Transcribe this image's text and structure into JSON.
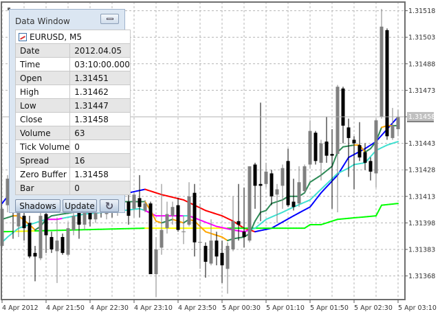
{
  "data_window": {
    "title": "Data Window",
    "symbol": "EURUSD, M5",
    "rows": [
      {
        "label": "Date",
        "value": "2012.04.05"
      },
      {
        "label": "Time",
        "value": "03:10:00.000"
      },
      {
        "label": "Open",
        "value": "1.31451"
      },
      {
        "label": "High",
        "value": "1.31462"
      },
      {
        "label": "Low",
        "value": "1.31447"
      },
      {
        "label": "Close",
        "value": "1.31458"
      },
      {
        "label": "Volume",
        "value": "63"
      },
      {
        "label": "Tick Volume",
        "value": "0"
      },
      {
        "label": "Spread",
        "value": "16"
      },
      {
        "label": "Zero Buffer",
        "value": "1.31458"
      },
      {
        "label": "Bar",
        "value": "0"
      }
    ],
    "buttons": {
      "shadows": "Shadows",
      "update": "Update",
      "refresh_icon": "refresh-icon"
    }
  },
  "chart_data": {
    "type": "candlestick",
    "symbol": "EURUSD",
    "timeframe": "M5",
    "first_bar": "4 Apr 21:10",
    "last_bar": "5 Apr 03:10",
    "current_price": "1.31458",
    "ylim": [
      1.31353,
      1.31525
    ],
    "y_ticks": [
      "1.31518",
      "1.31503",
      "1.31488",
      "1.31473",
      "1.31458",
      "1.31443",
      "1.31428",
      "1.31413",
      "1.31398",
      "1.31383",
      "1.31368"
    ],
    "x_ticks": [
      {
        "bar": 0,
        "label": "4 Apr 2012"
      },
      {
        "bar": 8,
        "label": "4 Apr 21:50"
      },
      {
        "bar": 16,
        "label": "4 Apr 22:30"
      },
      {
        "bar": 24,
        "label": "4 Apr 23:10"
      },
      {
        "bar": 32,
        "label": "4 Apr 23:50"
      },
      {
        "bar": 40,
        "label": "5 Apr 00:30"
      },
      {
        "bar": 48,
        "label": "5 Apr 01:10"
      },
      {
        "bar": 56,
        "label": "5 Apr 01:50"
      },
      {
        "bar": 64,
        "label": "5 Apr 02:30"
      },
      {
        "bar": 72,
        "label": "5 Apr 03:10"
      }
    ],
    "colors": {
      "up": "#808080",
      "down": "#000000",
      "grid": "#b4b4b4",
      "frame": "#6e6e6e"
    },
    "candles_ohlc": [
      [
        1.31385,
        1.31407,
        1.31384,
        1.31406
      ],
      [
        1.31408,
        1.31425,
        1.31404,
        1.31423
      ],
      [
        1.31415,
        1.31417,
        1.31389,
        1.31406
      ],
      [
        1.31396,
        1.31409,
        1.3139,
        1.31407
      ],
      [
        1.31402,
        1.31407,
        1.31388,
        1.31395
      ],
      [
        1.31398,
        1.31402,
        1.31378,
        1.31379
      ],
      [
        1.31381,
        1.31385,
        1.31365,
        1.31379
      ],
      [
        1.31378,
        1.31404,
        1.31377,
        1.31402
      ],
      [
        1.31403,
        1.31406,
        1.31381,
        1.31391
      ],
      [
        1.3139,
        1.31393,
        1.31381,
        1.31383
      ],
      [
        1.31382,
        1.31401,
        1.31364,
        1.31388
      ],
      [
        1.3139,
        1.31392,
        1.3138,
        1.31381
      ],
      [
        1.3138,
        1.31398,
        1.31379,
        1.31395
      ],
      [
        1.31394,
        1.31406,
        1.31391,
        1.31402
      ],
      [
        1.31406,
        1.31408,
        1.31389,
        1.31397
      ],
      [
        1.31397,
        1.31408,
        1.31394,
        1.31405
      ],
      [
        1.31405,
        1.3141,
        1.31396,
        1.314
      ],
      [
        1.314,
        1.31412,
        1.31398,
        1.31409
      ],
      [
        1.31409,
        1.31413,
        1.31401,
        1.31404
      ],
      [
        1.31403,
        1.31412,
        1.314,
        1.31408
      ],
      [
        1.31408,
        1.31411,
        1.31401,
        1.31404
      ],
      [
        1.31404,
        1.31413,
        1.31402,
        1.3141
      ],
      [
        1.3141,
        1.31415,
        1.31406,
        1.31412
      ],
      [
        1.3141,
        1.31419,
        1.31397,
        1.31402
      ],
      [
        1.31406,
        1.31415,
        1.31401,
        1.31414
      ],
      [
        1.31412,
        1.31425,
        1.31401,
        1.31407
      ],
      [
        1.31405,
        1.31411,
        1.31404,
        1.31409
      ],
      [
        1.31409,
        1.3141,
        1.31369,
        1.31369
      ],
      [
        1.31369,
        1.3139,
        1.31356,
        1.31383
      ],
      [
        1.31384,
        1.3142,
        1.3138,
        1.31394
      ],
      [
        1.31395,
        1.3141,
        1.31392,
        1.31403
      ],
      [
        1.31402,
        1.3141,
        1.31397,
        1.31407
      ],
      [
        1.31408,
        1.31412,
        1.31393,
        1.31394
      ],
      [
        1.31393,
        1.31402,
        1.31386,
        1.31393
      ],
      [
        1.31397,
        1.31421,
        1.31396,
        1.31413
      ],
      [
        1.31415,
        1.3142,
        1.31379,
        1.31387
      ],
      [
        1.31387,
        1.31409,
        1.31372,
        1.31387
      ],
      [
        1.31385,
        1.31387,
        1.31367,
        1.31376
      ],
      [
        1.31375,
        1.314,
        1.31374,
        1.31388
      ],
      [
        1.31388,
        1.31393,
        1.31374,
        1.31379
      ],
      [
        1.31381,
        1.31388,
        1.31364,
        1.31374
      ],
      [
        1.31372,
        1.31387,
        1.31358,
        1.31385
      ],
      [
        1.31383,
        1.31413,
        1.31382,
        1.31399
      ],
      [
        1.31399,
        1.3142,
        1.31388,
        1.31397
      ],
      [
        1.31393,
        1.31418,
        1.31384,
        1.3139
      ],
      [
        1.31388,
        1.3143,
        1.31387,
        1.3143
      ],
      [
        1.31431,
        1.31432,
        1.31406,
        1.31419
      ],
      [
        1.3142,
        1.31466,
        1.31399,
        1.31419
      ],
      [
        1.3142,
        1.31432,
        1.31418,
        1.31427
      ],
      [
        1.31426,
        1.31428,
        1.31408,
        1.31413
      ],
      [
        1.31414,
        1.3142,
        1.31398,
        1.31417
      ],
      [
        1.31419,
        1.31431,
        1.31406,
        1.31429
      ],
      [
        1.31433,
        1.3144,
        1.31407,
        1.31408
      ],
      [
        1.3141,
        1.31423,
        1.31405,
        1.31407
      ],
      [
        1.31409,
        1.3143,
        1.31407,
        1.31421
      ],
      [
        1.31416,
        1.31431,
        1.31415,
        1.3143
      ],
      [
        1.31431,
        1.31456,
        1.31429,
        1.3145
      ],
      [
        1.31449,
        1.3145,
        1.31431,
        1.31433
      ],
      [
        1.31432,
        1.31445,
        1.31422,
        1.31443
      ],
      [
        1.31444,
        1.31458,
        1.31432,
        1.31436
      ],
      [
        1.31437,
        1.31451,
        1.31406,
        1.31436
      ],
      [
        1.31437,
        1.31476,
        1.31404,
        1.31475
      ],
      [
        1.31474,
        1.31475,
        1.31443,
        1.31453
      ],
      [
        1.31452,
        1.31457,
        1.31424,
        1.31446
      ],
      [
        1.31445,
        1.31447,
        1.31417,
        1.31443
      ],
      [
        1.31442,
        1.31455,
        1.31433,
        1.31435
      ],
      [
        1.31438,
        1.31443,
        1.31428,
        1.31432
      ],
      [
        1.31433,
        1.31435,
        1.31422,
        1.31427
      ],
      [
        1.31426,
        1.31457,
        1.31418,
        1.31456
      ],
      [
        1.31458,
        1.31519,
        1.31457,
        1.31509
      ],
      [
        1.31507,
        1.31508,
        1.31445,
        1.31447
      ],
      [
        1.31446,
        1.31463,
        1.31445,
        1.31453
      ],
      [
        1.31451,
        1.31462,
        1.31447,
        1.31458
      ]
    ],
    "indicators": [
      {
        "name": "ma-slow-blue-red",
        "color": "#0000ff",
        "alt_color": "#ff0000",
        "alt_ranges": [
          [
            26,
            46
          ]
        ],
        "points": [
          [
            0,
            1.31409
          ],
          [
            1,
            1.31413
          ],
          [
            10,
            1.31414
          ],
          [
            23,
            1.31415
          ],
          [
            26,
            1.31417
          ],
          [
            29,
            1.31414
          ],
          [
            33,
            1.31411
          ],
          [
            37,
            1.31405
          ],
          [
            40,
            1.31402
          ],
          [
            42,
            1.31399
          ],
          [
            44,
            1.31395
          ],
          [
            46,
            1.31393
          ],
          [
            49,
            1.31395
          ],
          [
            53,
            1.31402
          ],
          [
            56,
            1.31407
          ],
          [
            58,
            1.31415
          ],
          [
            61,
            1.31425
          ],
          [
            63,
            1.31435
          ],
          [
            66,
            1.3144
          ],
          [
            68,
            1.31444
          ],
          [
            70,
            1.31451
          ],
          [
            72,
            1.31458
          ]
        ]
      },
      {
        "name": "ma-flat-lime-yellow",
        "color": "#00ff00",
        "alt_color": "#ffff00",
        "alt_ranges": [
          [
            2,
            6
          ],
          [
            26,
            41
          ]
        ],
        "points": [
          [
            0,
            1.31393
          ],
          [
            26,
            1.31395
          ],
          [
            55,
            1.31395
          ],
          [
            56,
            1.31397
          ],
          [
            58,
            1.31397
          ],
          [
            61,
            1.314
          ],
          [
            68,
            1.31402
          ],
          [
            69,
            1.31408
          ],
          [
            72,
            1.31409
          ]
        ]
      },
      {
        "name": "ma-mid-turquoise-magenta",
        "color": "#40e0d0",
        "alt_color": "#ff00ff",
        "alt_ranges": [
          [
            8,
            11
          ],
          [
            26,
            33
          ],
          [
            34,
            45
          ]
        ],
        "points": [
          [
            0,
            1.31387
          ],
          [
            1,
            1.3139
          ],
          [
            3,
            1.31395
          ],
          [
            5,
            1.31397
          ],
          [
            7,
            1.31399
          ],
          [
            8,
            1.314
          ],
          [
            10,
            1.314
          ],
          [
            15,
            1.31403
          ],
          [
            22,
            1.31405
          ],
          [
            25,
            1.31406
          ],
          [
            26,
            1.31405
          ],
          [
            28,
            1.31402
          ],
          [
            33,
            1.31402
          ],
          [
            34,
            1.31402
          ],
          [
            39,
            1.31396
          ],
          [
            42,
            1.31394
          ],
          [
            44,
            1.31393
          ],
          [
            45,
            1.31394
          ],
          [
            46,
            1.31395
          ],
          [
            48,
            1.314
          ],
          [
            51,
            1.31404
          ],
          [
            53,
            1.31407
          ],
          [
            56,
            1.31411
          ],
          [
            58,
            1.31417
          ],
          [
            61,
            1.31426
          ],
          [
            63,
            1.31429
          ],
          [
            64,
            1.31431
          ],
          [
            66,
            1.31432
          ],
          [
            68,
            1.31439
          ],
          [
            70,
            1.31442
          ],
          [
            72,
            1.31444
          ]
        ]
      },
      {
        "name": "ma-fast-seagreen-orange",
        "color": "#2e8b57",
        "alt_color": "#ffa500",
        "alt_ranges": [
          [
            2,
            6
          ],
          [
            26,
            29
          ],
          [
            31,
            33
          ],
          [
            34,
            41
          ],
          [
            64,
            66
          ],
          [
            69,
            71
          ]
        ],
        "points": [
          [
            0,
            1.314
          ],
          [
            2,
            1.31402
          ],
          [
            3,
            1.31402
          ],
          [
            5,
            1.31397
          ],
          [
            6,
            1.31394
          ],
          [
            7,
            1.31396
          ],
          [
            8,
            1.314
          ],
          [
            9,
            1.31402
          ],
          [
            15,
            1.31405
          ],
          [
            22,
            1.3141
          ],
          [
            26,
            1.3141
          ],
          [
            27,
            1.31405
          ],
          [
            28,
            1.31399
          ],
          [
            29,
            1.31398
          ],
          [
            31,
            1.314
          ],
          [
            33,
            1.31398
          ],
          [
            34,
            1.314
          ],
          [
            35,
            1.31399
          ],
          [
            37,
            1.31393
          ],
          [
            40,
            1.3139
          ],
          [
            41,
            1.31388
          ],
          [
            42,
            1.31389
          ],
          [
            44,
            1.3139
          ],
          [
            45,
            1.31392
          ],
          [
            46,
            1.31399
          ],
          [
            47,
            1.31404
          ],
          [
            48,
            1.31405
          ],
          [
            49,
            1.31409
          ],
          [
            51,
            1.31411
          ],
          [
            52,
            1.31413
          ],
          [
            54,
            1.31413
          ],
          [
            55,
            1.31415
          ],
          [
            56,
            1.31421
          ],
          [
            58,
            1.31425
          ],
          [
            60,
            1.3143
          ],
          [
            61,
            1.31438
          ],
          [
            62,
            1.31441
          ],
          [
            64,
            1.31442
          ],
          [
            65,
            1.31442
          ],
          [
            66,
            1.31438
          ],
          [
            67,
            1.3144
          ],
          [
            68,
            1.31444
          ],
          [
            69,
            1.31452
          ],
          [
            70,
            1.31453
          ],
          [
            71,
            1.31453
          ],
          [
            72,
            1.31453
          ]
        ]
      }
    ]
  }
}
